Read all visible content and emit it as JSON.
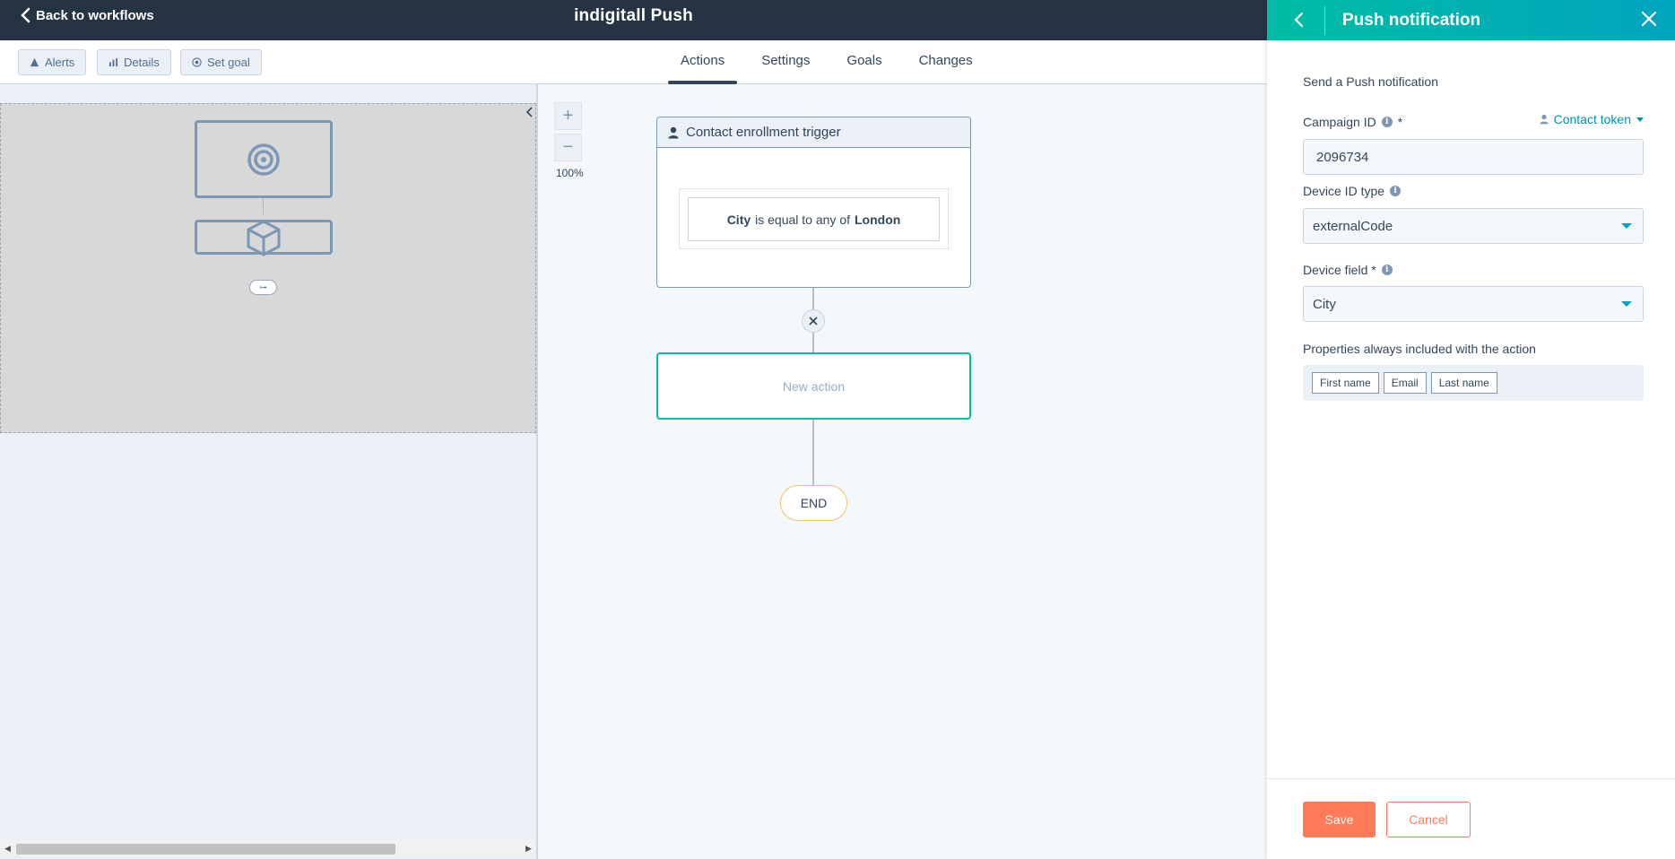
{
  "topbar": {
    "back_label": "Back to workflows",
    "title": "indigitall Push"
  },
  "toolbar": {
    "alerts_label": "Alerts",
    "details_label": "Details",
    "set_goal_label": "Set goal",
    "tabs": [
      {
        "label": "Actions",
        "active": true
      },
      {
        "label": "Settings",
        "active": false
      },
      {
        "label": "Goals",
        "active": false
      },
      {
        "label": "Changes",
        "active": false
      }
    ]
  },
  "minimap": {
    "end_label": "⊶"
  },
  "canvas": {
    "zoom_in": "+",
    "zoom_out": "−",
    "zoom_level": "100%",
    "trigger": {
      "title": "Contact enrollment trigger",
      "criteria_property": "City",
      "criteria_operator": "is equal to any of",
      "criteria_value": "London"
    },
    "new_action_label": "New action",
    "end_label": "END"
  },
  "panel": {
    "title": "Push notification",
    "description": "Send a Push notification",
    "campaign_id": {
      "label": "Campaign ID",
      "required": "*",
      "value": "2096734",
      "token_label": "Contact token"
    },
    "device_id_type": {
      "label": "Device ID type",
      "value": "externalCode"
    },
    "device_field": {
      "label": "Device field *",
      "value": "City"
    },
    "properties": {
      "label": "Properties always included with the action",
      "chips": [
        "First name",
        "Email",
        "Last name"
      ]
    },
    "save_label": "Save",
    "cancel_label": "Cancel"
  },
  "colors": {
    "topbar": "#253342",
    "accent_teal": "#00bda5",
    "accent_orange": "#ff7a59",
    "link": "#0091ae"
  }
}
